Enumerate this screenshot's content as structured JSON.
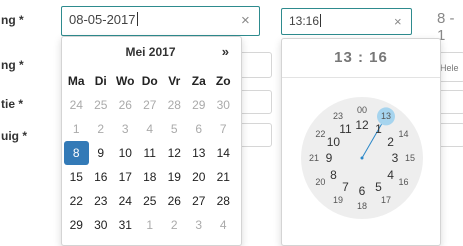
{
  "form": {
    "labels": [
      "ng *",
      "ng *",
      "tie *",
      "uig *"
    ],
    "right_sliver_text": "8 - 1",
    "right_sliver_small": "Hele"
  },
  "date_field": {
    "value": "08-05-2017",
    "clear_icon": "×"
  },
  "time_field": {
    "value": "13:16",
    "clear_icon": "×"
  },
  "calendar": {
    "month_title": "Mei 2017",
    "next_label": "»",
    "weekdays": [
      "Ma",
      "Di",
      "Wo",
      "Do",
      "Vr",
      "Za",
      "Zo"
    ],
    "weeks": [
      [
        24,
        25,
        26,
        27,
        28,
        29,
        30
      ],
      [
        1,
        2,
        3,
        4,
        5,
        6,
        7
      ],
      [
        8,
        9,
        10,
        11,
        12,
        13,
        14
      ],
      [
        15,
        16,
        17,
        18,
        19,
        20,
        21
      ],
      [
        22,
        23,
        24,
        25,
        26,
        27,
        28
      ],
      [
        29,
        30,
        31,
        1,
        2,
        3,
        4
      ]
    ],
    "muted_rows": [
      0,
      1
    ],
    "muted_last_row_from": 3,
    "selected_day": 8
  },
  "clock": {
    "header": "13 : 16",
    "selected_hour": 13,
    "accent_color": "#a6d4ee",
    "hand_color": "#2a87c8",
    "outer_hours": [
      "00",
      "13",
      "14",
      "15",
      "16",
      "17",
      "18",
      "19",
      "20",
      "21",
      "22",
      "23"
    ],
    "inner_hours": [
      "12",
      "1",
      "2",
      "3",
      "4",
      "5",
      "6",
      "7",
      "8",
      "9",
      "10",
      "11"
    ]
  }
}
